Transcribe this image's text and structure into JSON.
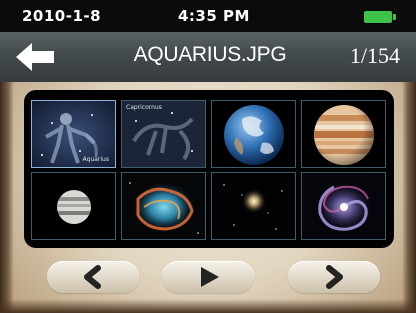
{
  "status": {
    "date": "2010-1-8",
    "time": "4:35 PM",
    "battery_icon": "battery-full-icon",
    "battery_color": "#3fc24a"
  },
  "header": {
    "back_icon": "back-arrow-icon",
    "file_name": "AQUARIUS.JPG",
    "page_counter": "1/154"
  },
  "thumbnails": [
    {
      "name": "aquarius-constellation",
      "label": "Aquarius",
      "selected": true
    },
    {
      "name": "capricornus-constellation",
      "label": "Capricornus",
      "selected": false
    },
    {
      "name": "earth",
      "label": "",
      "selected": false
    },
    {
      "name": "jupiter",
      "label": "",
      "selected": false
    },
    {
      "name": "saturn-like-planet",
      "label": "",
      "selected": false
    },
    {
      "name": "crab-nebula",
      "label": "",
      "selected": false
    },
    {
      "name": "star-cluster",
      "label": "",
      "selected": false
    },
    {
      "name": "spiral-galaxy",
      "label": "",
      "selected": false
    }
  ],
  "controls": {
    "previous_icon": "chevron-left-icon",
    "play_icon": "play-icon",
    "next_icon": "chevron-right-icon"
  },
  "colors": {
    "status_bar": "#0b0b0b",
    "title_bar": "#434a4e",
    "thumb_panel": "#000000",
    "selected_border": "#8fb4d8"
  }
}
